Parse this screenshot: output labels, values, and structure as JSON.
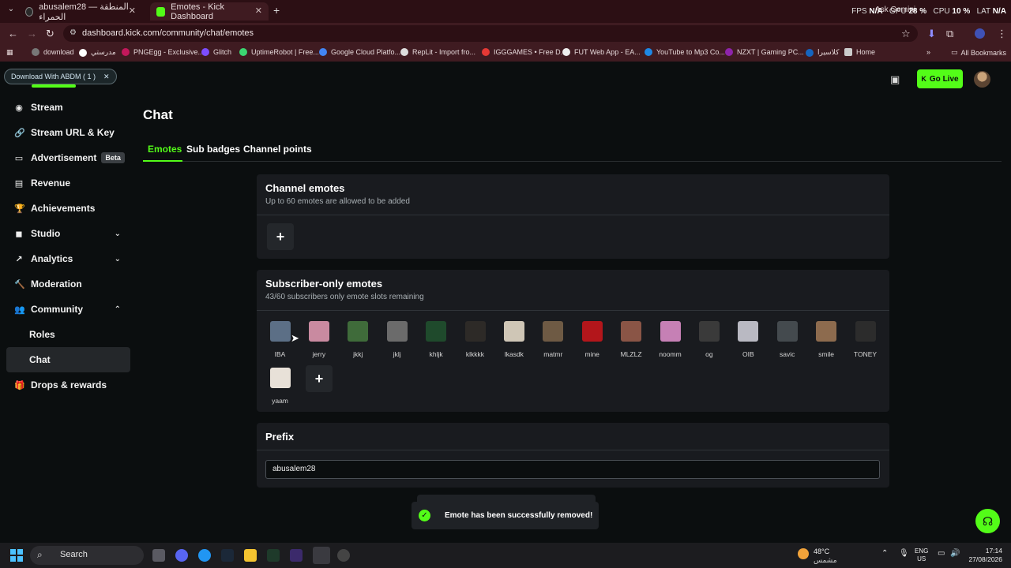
{
  "browser": {
    "tabs": [
      {
        "title": "abusalem28 — المنطقة الحمراء",
        "close": "✕"
      },
      {
        "title": "Emotes - Kick Dashboard",
        "close": "✕"
      }
    ],
    "new_tab": "+",
    "gemini_label": "Ask Gemini",
    "perf": {
      "fps_label": "FPS",
      "fps_value": "N/A",
      "gpu_label": "GPU",
      "gpu_value": "28 %",
      "cpu_label": "CPU",
      "cpu_value": "10 %",
      "lat_label": "LAT",
      "lat_value": "N/A"
    },
    "url": "dashboard.kick.com/community/chat/emotes",
    "bookmarks": [
      {
        "label": "download",
        "color": "#777"
      },
      {
        "label": "مدرستي",
        "color": "#fff"
      },
      {
        "label": "PNGEgg - Exclusive...",
        "color": "#c2185b"
      },
      {
        "label": "Glitch",
        "color": "#7c4dff"
      },
      {
        "label": "UptimeRobot | Free...",
        "color": "#3bd671"
      },
      {
        "label": "Google Cloud Platfo...",
        "color": "#4285f4"
      },
      {
        "label": "RepLit - Import fro...",
        "color": "#ddd"
      },
      {
        "label": "IGGGAMES • Free D...",
        "color": "#e53935"
      },
      {
        "label": "FUT Web App - EA...",
        "color": "#eee"
      },
      {
        "label": "YouTube to Mp3 Co...",
        "color": "#1e88e5"
      },
      {
        "label": "NZXT | Gaming PC...",
        "color": "#8e24aa"
      },
      {
        "label": "كلاسيرا",
        "color": "#1565c0"
      },
      {
        "label": "Home",
        "color": "#ccc"
      }
    ],
    "all_bookmarks": "All Bookmarks"
  },
  "extension_banner": {
    "label": "Download With ABDM ( 1 )",
    "close": "✕"
  },
  "sidebar": {
    "items": [
      {
        "label": "Stream",
        "icon": "◉"
      },
      {
        "label": "Stream URL & Key",
        "icon": "🔗"
      },
      {
        "label": "Advertisement",
        "icon": "▭",
        "badge": "Beta"
      },
      {
        "label": "Revenue",
        "icon": "▤"
      },
      {
        "label": "Achievements",
        "icon": "🏆"
      },
      {
        "label": "Studio",
        "icon": "◼"
      },
      {
        "label": "Analytics",
        "icon": "↗"
      },
      {
        "label": "Moderation",
        "icon": "🔨"
      },
      {
        "label": "Community",
        "icon": "👥"
      },
      {
        "label": "Roles",
        "icon": ""
      },
      {
        "label": "Chat",
        "icon": ""
      },
      {
        "label": "Drops & rewards",
        "icon": "🎁"
      }
    ]
  },
  "header": {
    "go_live": "Go Live"
  },
  "main": {
    "title": "Chat",
    "tabs": [
      "Emotes",
      "Sub badges",
      "Channel points"
    ],
    "channel_emotes": {
      "title": "Channel emotes",
      "subtitle": "Up to 60 emotes are allowed to be added",
      "add": "+"
    },
    "subscriber_emotes": {
      "title": "Subscriber-only emotes",
      "subtitle": "43/60 subscribers only emote slots remaining",
      "emotes": [
        {
          "name": "IBA",
          "color": "#5c6f86"
        },
        {
          "name": "jerry",
          "color": "#c98aa0"
        },
        {
          "name": "jkkj",
          "color": "#3f6b3a"
        },
        {
          "name": "jklj",
          "color": "#6b6b6b"
        },
        {
          "name": "khljk",
          "color": "#1f4a2c"
        },
        {
          "name": "klkkkk",
          "color": "#2d2a27"
        },
        {
          "name": "lkasdk",
          "color": "#cfc6b6"
        },
        {
          "name": "matmr",
          "color": "#6e5a44"
        },
        {
          "name": "mine",
          "color": "#b3161b"
        },
        {
          "name": "MLZLZ",
          "color": "#8a5546"
        },
        {
          "name": "noomm",
          "color": "#c680b5"
        },
        {
          "name": "og",
          "color": "#3a3a3a"
        },
        {
          "name": "OIB",
          "color": "#b9b9c2"
        },
        {
          "name": "savic",
          "color": "#444a4e"
        },
        {
          "name": "smile",
          "color": "#8d6b4e"
        },
        {
          "name": "TONEY",
          "color": "#2c2c2c"
        },
        {
          "name": "yaam",
          "color": "#e8e1d8"
        }
      ],
      "add": "+"
    },
    "prefix": {
      "title": "Prefix",
      "value": "abusalem28"
    }
  },
  "toast": {
    "message": "Emote has been successfully removed!",
    "icon": "✓"
  },
  "taskbar": {
    "search": "Search",
    "weather_temp": "48°C",
    "weather_desc": "مشمس",
    "lang_line1": "ENG",
    "lang_line2": "US",
    "time": "17:14",
    "date": "27/08/2026"
  }
}
